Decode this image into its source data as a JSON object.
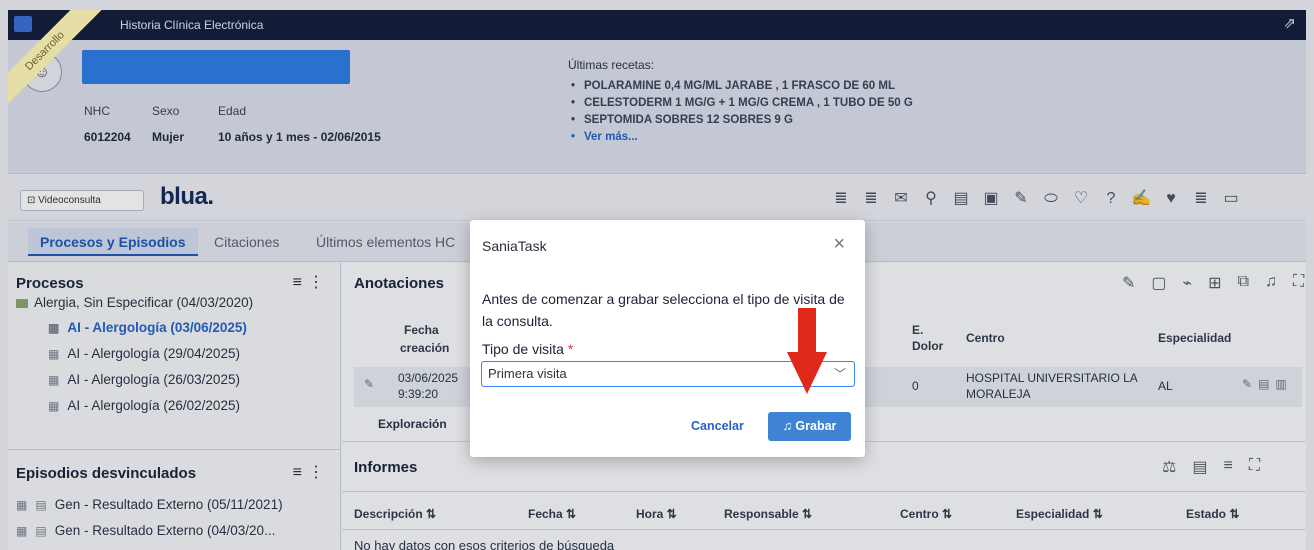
{
  "app": {
    "title": "Historia Clínica Electrónica",
    "env_badge": "Desarrollo",
    "brand": "blua."
  },
  "patient": {
    "labels": {
      "nhc": "NHC",
      "sexo": "Sexo",
      "edad": "Edad"
    },
    "nhc": "6012204",
    "sexo": "Mujer",
    "edad": "10 años y 1 mes - 02/06/2015"
  },
  "recetas": {
    "title": "Últimas recetas:",
    "items": [
      "POLARAMINE 0,4 MG/ML JARABE , 1 FRASCO DE 60 ML",
      "CELESTODERM 1 MG/G + 1 MG/G CREMA , 1 TUBO DE 50 G",
      "SEPTOMIDA SOBRES 12 SOBRES 9 G"
    ],
    "more": "Ver más..."
  },
  "toolbar": {
    "video_label": "Videoconsulta"
  },
  "tabs": [
    "Procesos y Episodios",
    "Citaciones",
    "Últimos elementos HC"
  ],
  "procesos": {
    "title": "Procesos",
    "root": "Alergia, Sin Especificar (04/03/2020)",
    "items": [
      "AI - Alergología (03/06/2025)",
      "AI - Alergología (29/04/2025)",
      "AI - Alergología (26/03/2025)",
      "AI - Alergología (26/02/2025)"
    ]
  },
  "episodios": {
    "title": "Episodios desvinculados",
    "items": [
      "Gen - Resultado Externo (05/11/2021)",
      "Gen - Resultado Externo (04/03/20..."
    ]
  },
  "anotaciones": {
    "title": "Anotaciones",
    "columns": {
      "fecha": "Fecha",
      "creacion": "creación",
      "dolor1": "E.",
      "dolor2": "Dolor",
      "centro": "Centro",
      "especialidad": "Especialidad"
    },
    "row": {
      "fecha1": "03/06/2025",
      "fecha2": "9:39:20",
      "dolor": "0",
      "centro1": "HOSPITAL UNIVERSITARIO LA",
      "centro2": "MORALEJA",
      "especialidad": "AL"
    },
    "next_row": "Exploración"
  },
  "informes": {
    "title": "Informes",
    "columns": [
      "Descripción",
      "Fecha",
      "Hora",
      "Responsable",
      "Centro",
      "Especialidad",
      "Estado"
    ],
    "empty": "No hay datos con esos criterios de búsqueda"
  },
  "modal": {
    "title": "SaniaTask",
    "message": "Antes de comenzar a grabar selecciona el tipo de visita de la consulta.",
    "field_label": "Tipo de visita",
    "required_mark": "*",
    "selected": "Primera visita",
    "cancel": "Cancelar",
    "record": "Grabar"
  },
  "colors": {
    "titlebar": "#141d3a",
    "accent": "#2563c9",
    "primary_button": "#3f83d4",
    "annotation_arrow": "#e0281b"
  }
}
